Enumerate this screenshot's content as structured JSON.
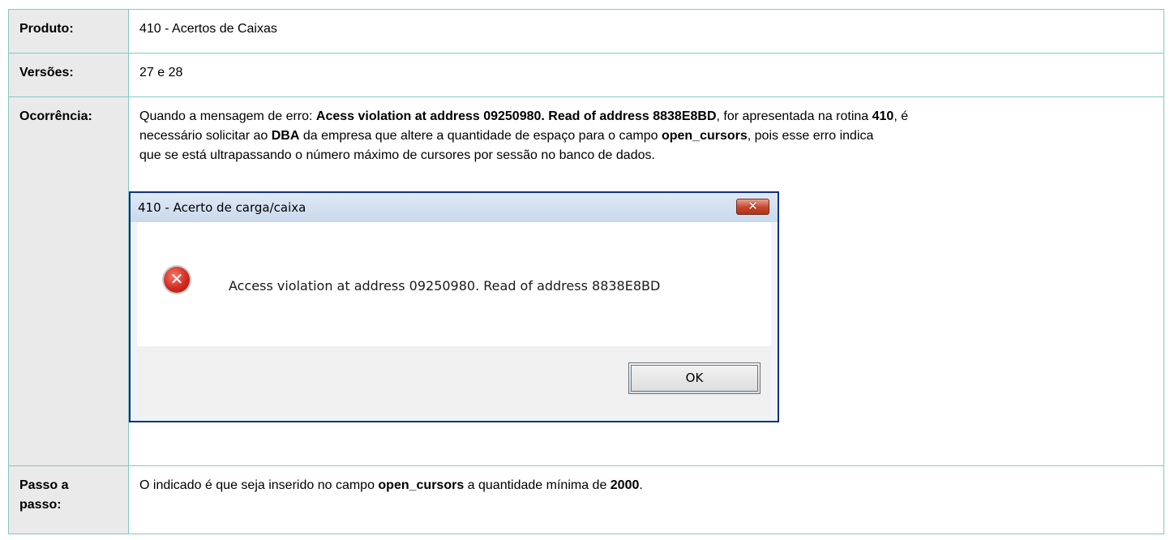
{
  "rows": [
    {
      "label": "Produto:",
      "value": "410 - Acertos de Caixas"
    },
    {
      "label": "Versões:",
      "value": "27 e 28"
    },
    {
      "label": "Ocorrência:"
    },
    {
      "label_line1": "Passo a",
      "label_line2": "passo:"
    }
  ],
  "ocorrencia": {
    "p1": "Quando a mensagem de erro: ",
    "b1": "Acess violation at address 09250980. Read of address 8838E8BD",
    "p2": ", for apresentada na rotina ",
    "b2": "410",
    "p3": ",  é",
    "line2_a": "necessário solicitar ao ",
    "b3": "DBA",
    "line2_b": " da empresa que altere a quantidade de espaço para o campo ",
    "b4": "open_cursors",
    "line2_c": ", pois esse erro indica",
    "line3": "que se está ultrapassando o número máximo de cursores por sessão no banco de dados."
  },
  "dialog": {
    "title": "410 - Acerto de carga/caixa",
    "close_glyph": "✕",
    "icon": "error-icon",
    "icon_glyph": "✕",
    "message": "Access violation at address 09250980. Read of address 8838E8BD",
    "ok_label": "OK"
  },
  "passo": {
    "p1": "O indicado é que seja inserido no campo ",
    "b1": "open_cursors",
    "p2": "  a quantidade mínima de ",
    "b2": "2000",
    "p3": "."
  },
  "colors": {
    "border": "#86c6c9",
    "label_bg": "#eaeaea",
    "dialog_frame": "#13317a"
  }
}
